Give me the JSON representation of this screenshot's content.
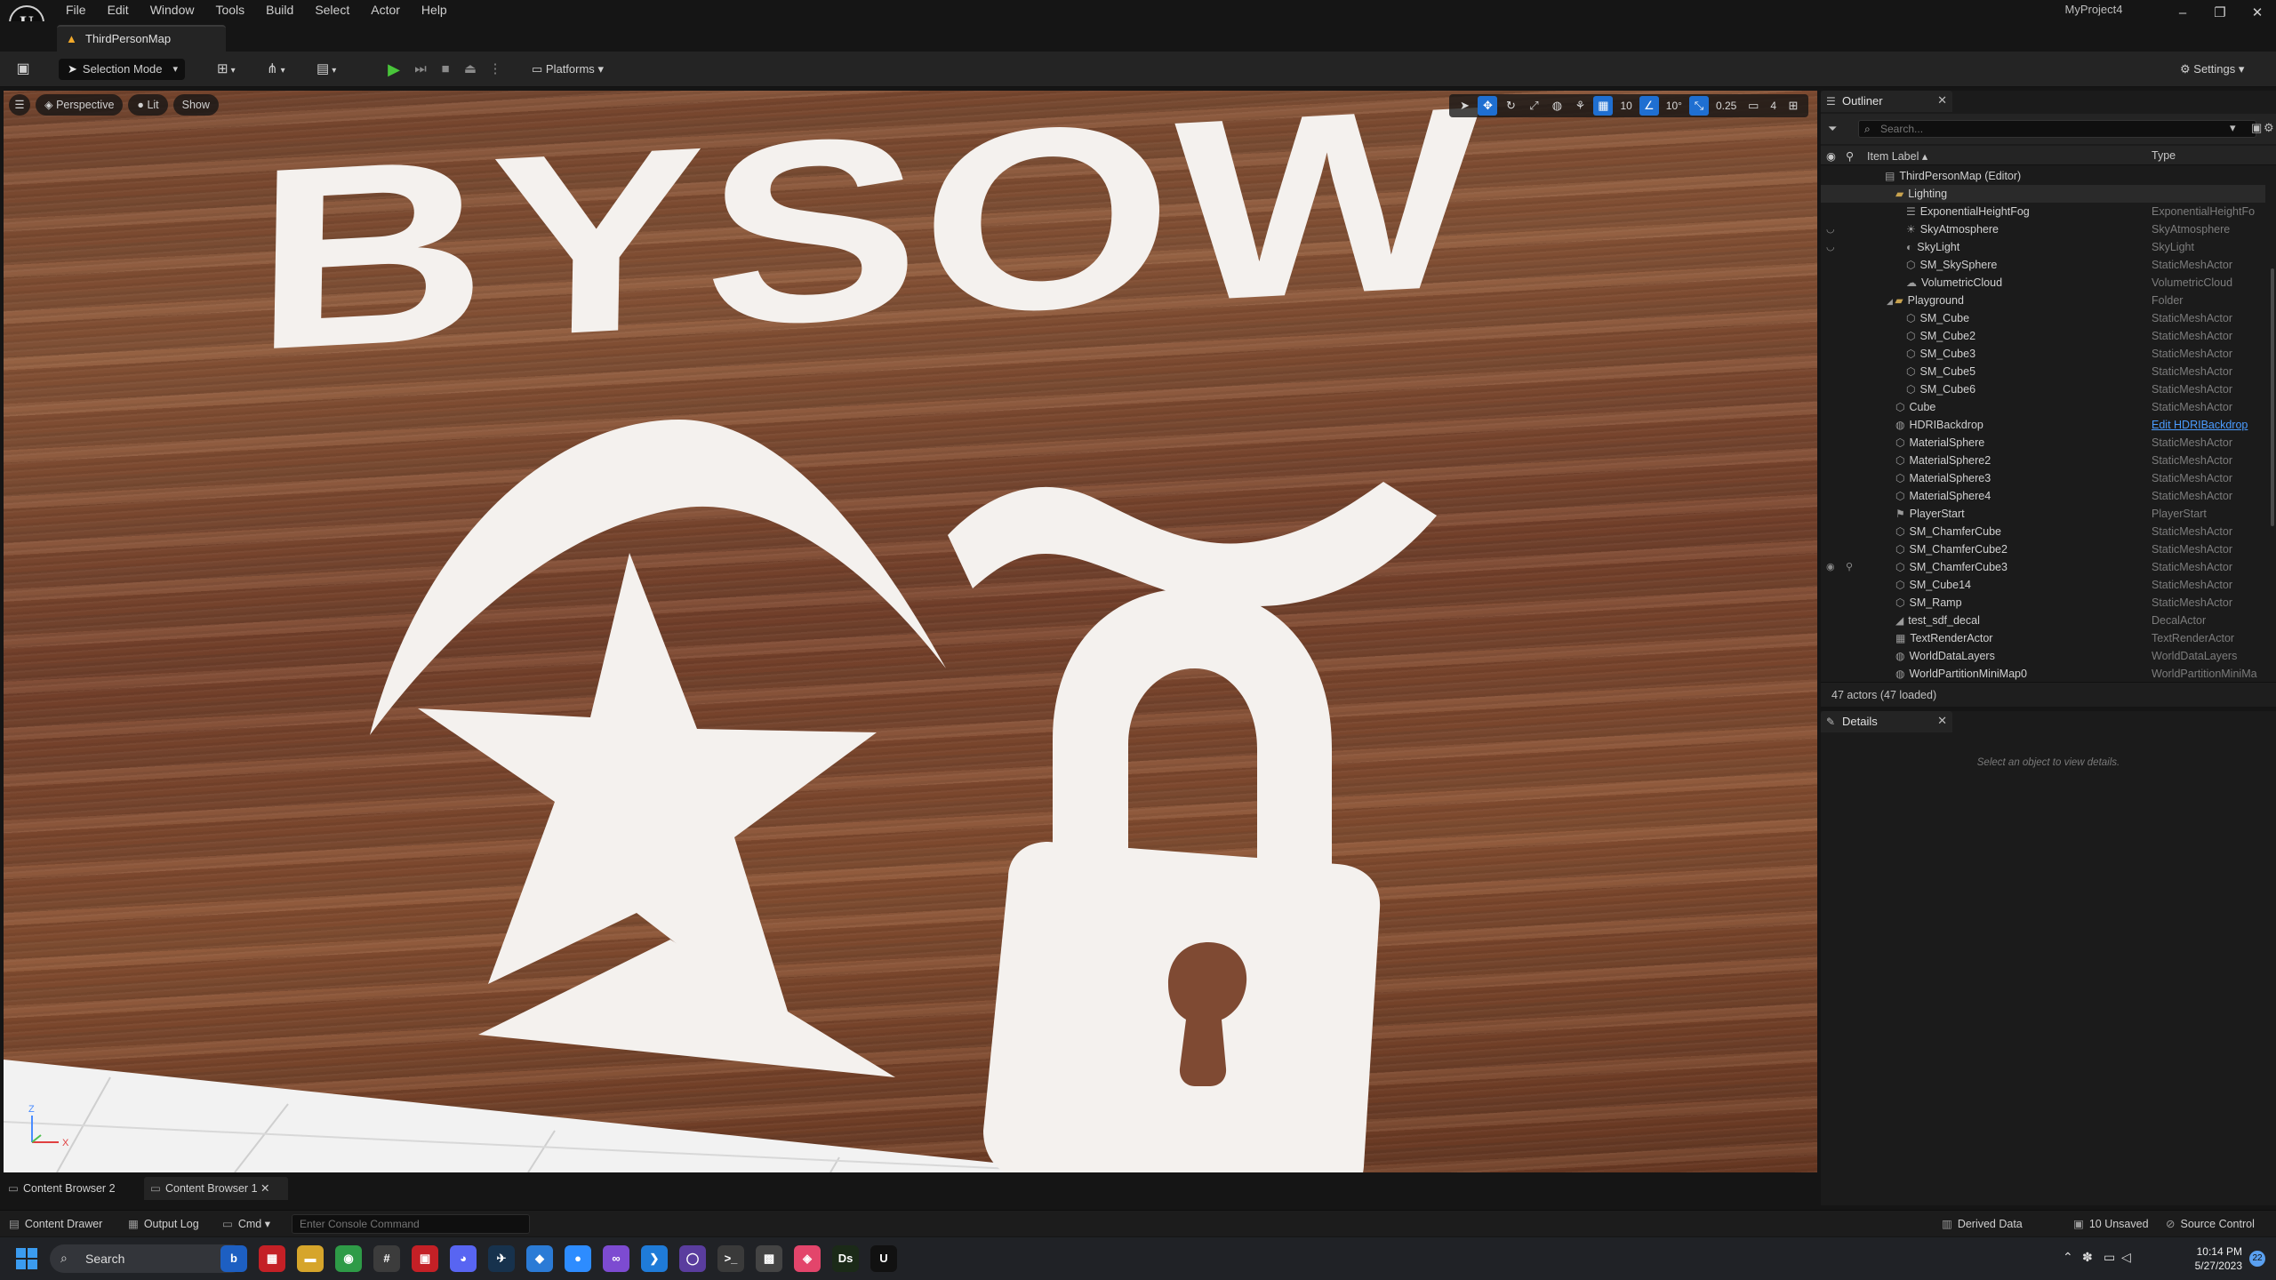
{
  "menu": {
    "items": [
      "File",
      "Edit",
      "Window",
      "Tools",
      "Build",
      "Select",
      "Actor",
      "Help"
    ],
    "project_name": "MyProject4",
    "window_controls": {
      "minimize": "–",
      "restore": "❐",
      "close": "✕"
    }
  },
  "level_tab": {
    "label": "ThirdPersonMap"
  },
  "toolbar": {
    "selection_mode": "Selection Mode",
    "platforms": "Platforms",
    "settings": "Settings"
  },
  "viewport": {
    "perspective": "Perspective",
    "lit": "Lit",
    "show": "Show",
    "grid_snap": "10",
    "rotate_snap": "10°",
    "scale_snap": "0.25",
    "camera_speed": "4",
    "axis_x": "X",
    "axis_z": "Z",
    "decal_text": "BYSOW",
    "decal_shapes": [
      "crescent",
      "tilde",
      "star",
      "padlock",
      "triangle"
    ]
  },
  "outliner": {
    "tab_label": "Outliner",
    "search_placeholder": "Search...",
    "col_label": "Item Label ▴",
    "col_type": "Type",
    "rows": [
      {
        "label": "ThirdPersonMap (Editor)",
        "type": "",
        "indent": 0,
        "icon": "map-icon"
      },
      {
        "label": "Lighting",
        "type": "",
        "indent": 1,
        "icon": "folder-icon",
        "folder": true,
        "selected": true
      },
      {
        "label": "ExponentialHeightFog",
        "type": "ExponentialHeightFo",
        "indent": 2,
        "icon": "fog-icon"
      },
      {
        "label": "SkyAtmosphere",
        "type": "SkyAtmosphere",
        "indent": 2,
        "icon": "atmosphere-icon",
        "vis": true
      },
      {
        "label": "SkyLight",
        "type": "SkyLight",
        "indent": 2,
        "icon": "skylight-icon",
        "vis": true
      },
      {
        "label": "SM_SkySphere",
        "type": "StaticMeshActor",
        "indent": 2,
        "icon": "mesh-icon"
      },
      {
        "label": "VolumetricCloud",
        "type": "VolumetricCloud",
        "indent": 2,
        "icon": "cloud-icon"
      },
      {
        "label": "Playground",
        "type": "Folder",
        "indent": 1,
        "icon": "folder-icon",
        "folder": true,
        "expanded": true
      },
      {
        "label": "SM_Cube",
        "type": "StaticMeshActor",
        "indent": 2,
        "icon": "mesh-icon"
      },
      {
        "label": "SM_Cube2",
        "type": "StaticMeshActor",
        "indent": 2,
        "icon": "mesh-icon"
      },
      {
        "label": "SM_Cube3",
        "type": "StaticMeshActor",
        "indent": 2,
        "icon": "mesh-icon"
      },
      {
        "label": "SM_Cube5",
        "type": "StaticMeshActor",
        "indent": 2,
        "icon": "mesh-icon"
      },
      {
        "label": "SM_Cube6",
        "type": "StaticMeshActor",
        "indent": 2,
        "icon": "mesh-icon"
      },
      {
        "label": "Cube",
        "type": "StaticMeshActor",
        "indent": 1,
        "icon": "mesh-icon"
      },
      {
        "label": "HDRIBackdrop",
        "type": "Edit HDRIBackdrop",
        "indent": 1,
        "icon": "sphere-icon",
        "link": true
      },
      {
        "label": "MaterialSphere",
        "type": "StaticMeshActor",
        "indent": 1,
        "icon": "mesh-icon"
      },
      {
        "label": "MaterialSphere2",
        "type": "StaticMeshActor",
        "indent": 1,
        "icon": "mesh-icon"
      },
      {
        "label": "MaterialSphere3",
        "type": "StaticMeshActor",
        "indent": 1,
        "icon": "mesh-icon"
      },
      {
        "label": "MaterialSphere4",
        "type": "StaticMeshActor",
        "indent": 1,
        "icon": "mesh-icon"
      },
      {
        "label": "PlayerStart",
        "type": "PlayerStart",
        "indent": 1,
        "icon": "flag-icon"
      },
      {
        "label": "SM_ChamferCube",
        "type": "StaticMeshActor",
        "indent": 1,
        "icon": "mesh-icon"
      },
      {
        "label": "SM_ChamferCube2",
        "type": "StaticMeshActor",
        "indent": 1,
        "icon": "mesh-icon"
      },
      {
        "label": "SM_ChamferCube3",
        "type": "StaticMeshActor",
        "indent": 1,
        "icon": "mesh-icon",
        "hover": true
      },
      {
        "label": "SM_Cube14",
        "type": "StaticMeshActor",
        "indent": 1,
        "icon": "mesh-icon"
      },
      {
        "label": "SM_Ramp",
        "type": "StaticMeshActor",
        "indent": 1,
        "icon": "mesh-icon"
      },
      {
        "label": "test_sdf_decal",
        "type": "DecalActor",
        "indent": 1,
        "icon": "decal-icon"
      },
      {
        "label": "TextRenderActor",
        "type": "TextRenderActor",
        "indent": 1,
        "icon": "text-icon"
      },
      {
        "label": "WorldDataLayers",
        "type": "WorldDataLayers",
        "indent": 1,
        "icon": "sphere-icon"
      },
      {
        "label": "WorldPartitionMiniMap0",
        "type": "WorldPartitionMiniMa",
        "indent": 1,
        "icon": "sphere-icon"
      }
    ],
    "footer": "47 actors (47 loaded)"
  },
  "details": {
    "tab_label": "Details",
    "empty_message": "Select an object to view details."
  },
  "content_tabs": [
    "Content Browser 2",
    "Content Browser 1"
  ],
  "statusbar": {
    "content_drawer": "Content Drawer",
    "output_log": "Output Log",
    "cmd": "Cmd",
    "console_placeholder": "Enter Console Command",
    "derived_data": "Derived Data",
    "unsaved": "10 Unsaved",
    "source_control": "Source Control"
  },
  "taskbar": {
    "search": "Search",
    "time": "10:14 PM",
    "date": "5/27/2023",
    "notification_count": "22",
    "apps": [
      {
        "name": "bing-app-icon",
        "glyph": "b",
        "color": "#1d5fc2"
      },
      {
        "name": "tiles-app-icon",
        "glyph": "▦",
        "color": "#c42026"
      },
      {
        "name": "file-explorer-icon",
        "glyph": "▬",
        "color": "#d6a52b"
      },
      {
        "name": "chrome-icon",
        "glyph": "◉",
        "color": "#2e9b47"
      },
      {
        "name": "slack-icon",
        "glyph": "#",
        "color": "#3c3c3c"
      },
      {
        "name": "tasks-app-icon",
        "glyph": "▣",
        "color": "#c42026"
      },
      {
        "name": "discord-icon",
        "glyph": "◕",
        "color": "#5865f2"
      },
      {
        "name": "steam-icon",
        "glyph": "✈",
        "color": "#17324d"
      },
      {
        "name": "paint-app-icon",
        "glyph": "◆",
        "color": "#2b7bd6"
      },
      {
        "name": "zoom-icon",
        "glyph": "●",
        "color": "#2d8cff"
      },
      {
        "name": "visual-studio-icon",
        "glyph": "∞",
        "color": "#7d4bd1"
      },
      {
        "name": "vscode-icon",
        "glyph": "❯",
        "color": "#1f7bd8"
      },
      {
        "name": "github-icon",
        "glyph": "◯",
        "color": "#5a3d9e"
      },
      {
        "name": "terminal-icon",
        "glyph": ">_",
        "color": "#3a3a3a"
      },
      {
        "name": "chip-app-icon",
        "glyph": "▩",
        "color": "#444"
      },
      {
        "name": "figma-app-icon",
        "glyph": "◈",
        "color": "#e3456b"
      },
      {
        "name": "daz-studio-icon",
        "glyph": "Ds",
        "color": "#1b2a18"
      },
      {
        "name": "unreal-editor-icon",
        "glyph": "U",
        "color": "#111"
      }
    ]
  }
}
